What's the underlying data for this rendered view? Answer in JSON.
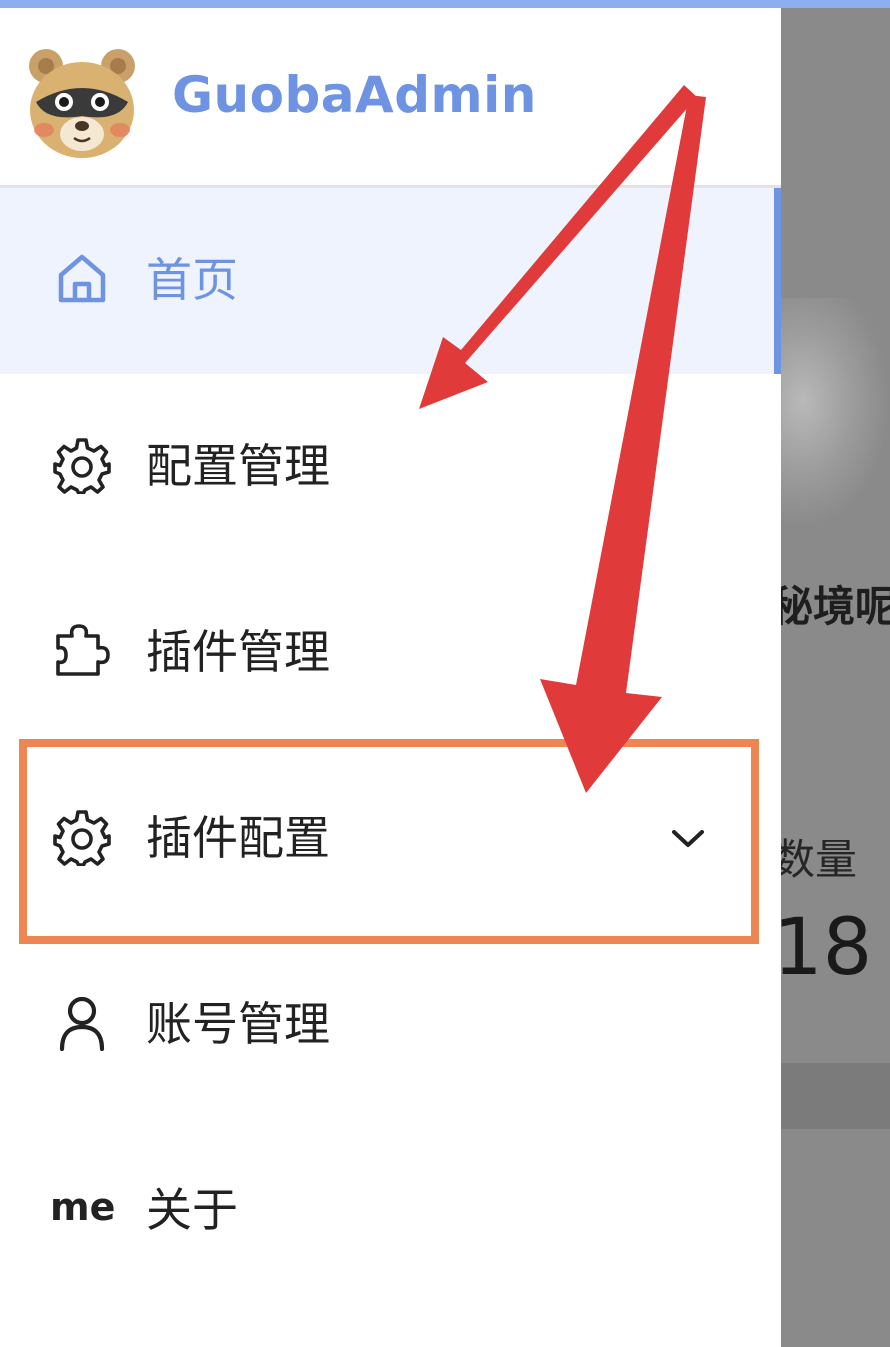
{
  "app": {
    "title": "GuobaAdmin"
  },
  "menu": {
    "items": [
      {
        "label": "首页",
        "icon": "home-icon",
        "active": true
      },
      {
        "label": "配置管理",
        "icon": "gear-icon"
      },
      {
        "label": "插件管理",
        "icon": "puzzle-icon"
      },
      {
        "label": "插件配置",
        "icon": "gear-icon",
        "expandable": true
      },
      {
        "label": "账号管理",
        "icon": "user-icon"
      },
      {
        "label": "关于",
        "icon_text": "me"
      }
    ]
  },
  "background_page": {
    "text1": "秘境呢",
    "text2": "数量",
    "number": "18"
  },
  "colors": {
    "accent": "#6e93e3",
    "active_bg": "#eef3fd",
    "highlight_box": "#ee8653",
    "arrow": "#e03a3a"
  }
}
